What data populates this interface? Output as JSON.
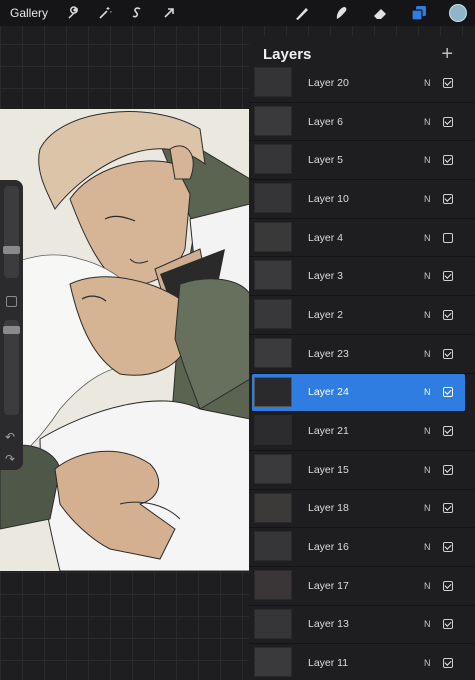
{
  "topbar": {
    "gallery_label": "Gallery",
    "left_tools": [
      "wrench-icon",
      "magic-wand-icon",
      "selection-s-icon",
      "transform-arrow-icon"
    ],
    "right_tools": [
      "brush-icon",
      "smudge-icon",
      "eraser-icon",
      "layers-icon"
    ],
    "active_color": "#8eb6c7"
  },
  "panel": {
    "title": "Layers",
    "add_label": "+"
  },
  "layers": [
    {
      "name": "Layer 20",
      "blend": "N",
      "visible": true
    },
    {
      "name": "Layer 6",
      "blend": "N",
      "visible": true
    },
    {
      "name": "Layer 5",
      "blend": "N",
      "visible": true
    },
    {
      "name": "Layer 10",
      "blend": "N",
      "visible": true
    },
    {
      "name": "Layer 4",
      "blend": "N",
      "visible": false
    },
    {
      "name": "Layer 3",
      "blend": "N",
      "visible": true
    },
    {
      "name": "Layer 2",
      "blend": "N",
      "visible": true
    },
    {
      "name": "Layer 23",
      "blend": "N",
      "visible": true
    },
    {
      "name": "Layer 24",
      "blend": "N",
      "visible": true,
      "selected": true
    },
    {
      "name": "Layer 21",
      "blend": "N",
      "visible": true
    },
    {
      "name": "Layer 15",
      "blend": "N",
      "visible": true
    },
    {
      "name": "Layer 18",
      "blend": "N",
      "visible": true
    },
    {
      "name": "Layer 16",
      "blend": "N",
      "visible": true
    },
    {
      "name": "Layer 17",
      "blend": "N",
      "visible": true
    },
    {
      "name": "Layer 13",
      "blend": "N",
      "visible": true
    },
    {
      "name": "Layer 11",
      "blend": "N",
      "visible": true
    }
  ],
  "colors": {
    "selection": "#2f7de1",
    "skin": "#d8b79a",
    "jacket": "#5a6452"
  }
}
